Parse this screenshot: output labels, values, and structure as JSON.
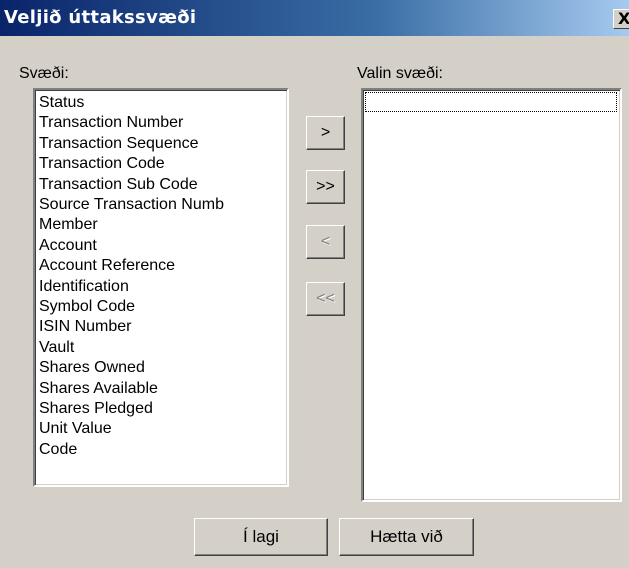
{
  "window": {
    "title": "Veljið úttakssvæði",
    "close_label": "X"
  },
  "available": {
    "label": "Svæði:",
    "items": [
      "Status",
      "Transaction Number",
      "Transaction Sequence",
      "Transaction Code",
      "Transaction Sub Code",
      "Source Transaction Numb",
      "Member",
      "Account",
      "Account Reference",
      "Identification",
      "Symbol Code",
      "ISIN Number",
      "Vault",
      "Shares Owned",
      "Shares Available",
      "Shares Pledged",
      "Unit Value",
      "Code"
    ]
  },
  "selected": {
    "label": "Valin svæði:",
    "items": []
  },
  "move_buttons": {
    "add_one": ">",
    "add_all": ">>",
    "remove_one": "<",
    "remove_all": "<<"
  },
  "footer": {
    "ok_label": "Í lagi",
    "cancel_label": "Hætta við"
  }
}
